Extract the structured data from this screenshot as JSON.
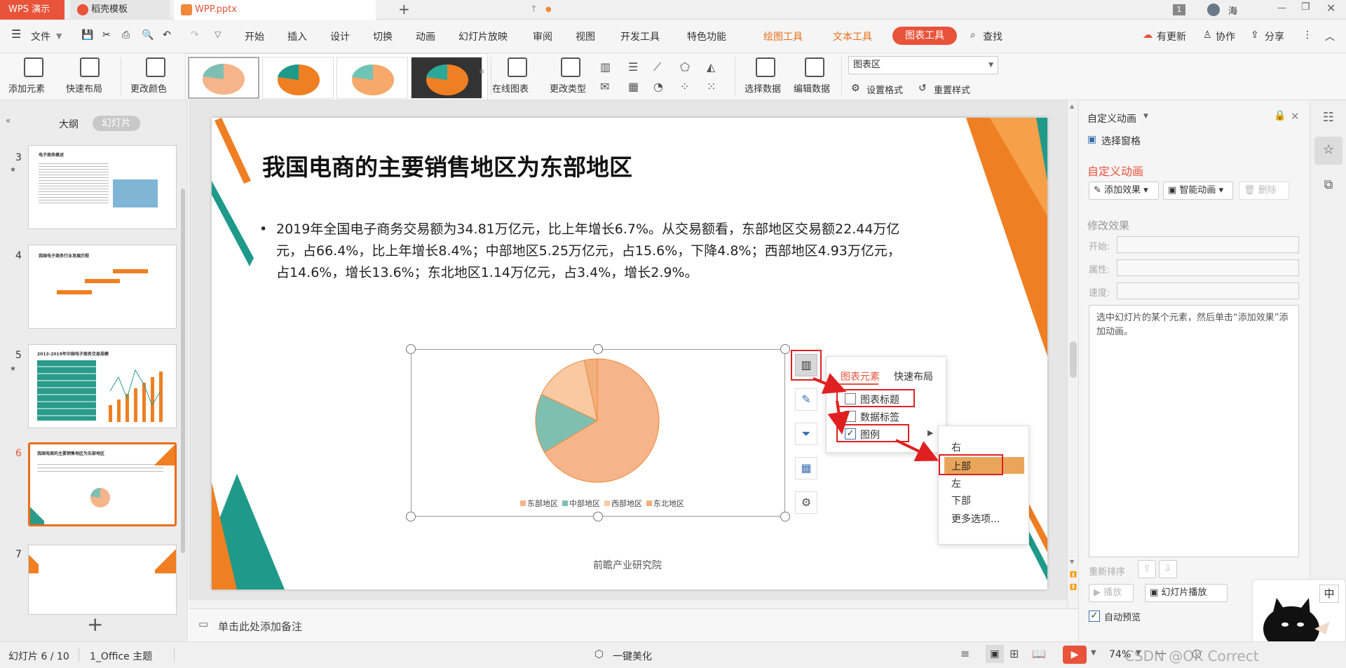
{
  "titlebar": {
    "tabs": [
      {
        "label": "WPS 演示"
      },
      {
        "label": "稻壳模板"
      },
      {
        "label": "WPP.pptx"
      }
    ],
    "badge": "1",
    "user": "海"
  },
  "menubar": {
    "file": "文件",
    "items": [
      "开始",
      "插入",
      "设计",
      "切换",
      "动画",
      "幻灯片放映",
      "审阅",
      "视图",
      "开发工具",
      "特色功能"
    ],
    "context": [
      "绘图工具",
      "文本工具",
      "图表工具"
    ],
    "search": "查找",
    "right": [
      "有更新",
      "协作",
      "分享"
    ]
  },
  "ribbon": {
    "add_element": "添加元素",
    "quick_layout": "快速布局",
    "change_color": "更改颜色",
    "online_chart": "在线图表",
    "change_type": "更改类型",
    "select_data": "选择数据",
    "edit_data": "编辑数据",
    "chart_area": "图表区",
    "set_format": "设置格式",
    "reset_style": "重置样式"
  },
  "leftpanel": {
    "tabs": [
      "大纲",
      "幻灯片"
    ],
    "slides": [
      {
        "num": "3",
        "title": "电子商务概述"
      },
      {
        "num": "4",
        "title": "我国电子商务行业发展历程"
      },
      {
        "num": "5",
        "title": "2013-2019年中国电子商务交易规模"
      },
      {
        "num": "6",
        "title": "我国电商的主要销售地区为东部地区"
      },
      {
        "num": "7",
        "title": ""
      }
    ],
    "add": "+"
  },
  "slide": {
    "title": "我国电商的主要销售地区为东部地区",
    "body_l1": "2019年全国电子商务交易额为34.81万亿元，比上年增长6.7%。从交易额看，东部地区交易额22.44万亿",
    "body_l2": "元，占66.4%，比上年增长8.4%；中部地区5.25万亿元，占15.6%，下降4.8%；西部地区4.93万亿元，",
    "body_l3": "占14.6%，增长13.6%；东北地区1.14万亿元，占3.4%，增长2.9%。",
    "source": "前瞻产业研究院"
  },
  "chart_data": {
    "type": "pie",
    "categories": [
      "东部地区",
      "中部地区",
      "西部地区",
      "东北地区"
    ],
    "values": [
      66.4,
      15.6,
      14.6,
      3.4
    ],
    "colors": [
      "#f6b48a",
      "#7fbfb2",
      "#f9c9a4",
      "#f3b07c"
    ],
    "legend": "bottom"
  },
  "popup": {
    "tabs": [
      "图表元素",
      "快速布局"
    ],
    "items": [
      {
        "label": "图表标题",
        "checked": false
      },
      {
        "label": "数据标签",
        "checked": false
      },
      {
        "label": "图例",
        "checked": true
      }
    ],
    "submenu": [
      "右",
      "上部",
      "左",
      "下部",
      "更多选项..."
    ]
  },
  "rightpanel": {
    "header": "自定义动画",
    "select_pane": "选择窗格",
    "section": "自定义动画",
    "add_effect": "添加效果",
    "smart_anim": "智能动画",
    "delete": "删除",
    "modify": "修改效果",
    "start": "开始:",
    "property": "属性:",
    "speed": "速度:",
    "hint": "选中幻灯片的某个元素，然后单击“添加效果”添加动画。",
    "reorder": "重新排序",
    "play": "播放",
    "slideshow": "幻灯片播放",
    "autopreview": "自动预览"
  },
  "notes": "单击此处添加备注",
  "statusbar": {
    "slide": "幻灯片 6 / 10",
    "theme": "1_Office 主题",
    "beautify": "一键美化",
    "zoom": "74%",
    "watermark": "CSDN @OK Correct"
  },
  "ime": "中"
}
